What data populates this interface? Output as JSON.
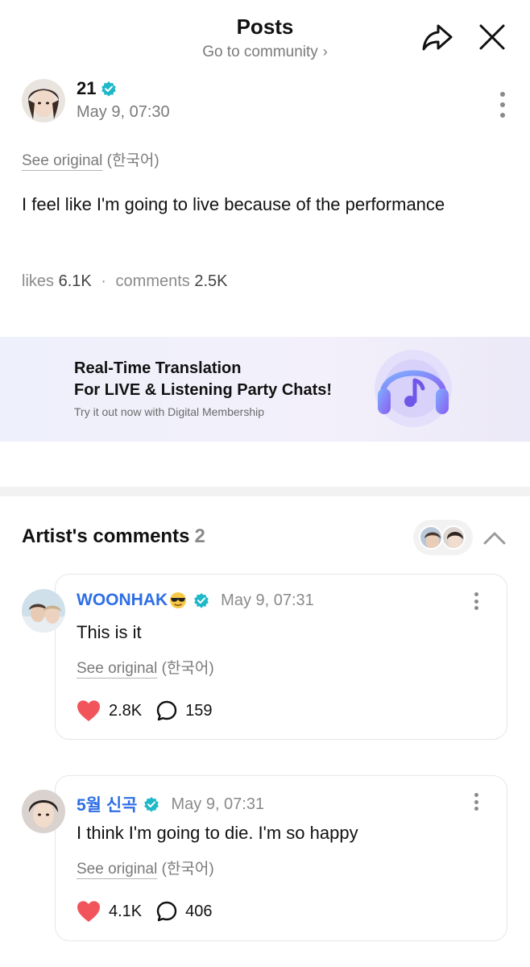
{
  "header": {
    "title": "Posts",
    "subtitle": "Go to community",
    "subtitle_chevron": "›"
  },
  "post": {
    "author": "21",
    "time": "May 9, 07:30",
    "see_original": "See original",
    "original_lang": "(한국어)",
    "body": "I feel like I'm going to live because of the performance",
    "likes_label": "likes",
    "likes_value": "6.1K",
    "separator": "·",
    "comments_label": "comments",
    "comments_value": "2.5K"
  },
  "banner": {
    "line1": "Real-Time Translation",
    "line2": "For LIVE & Listening Party Chats!",
    "line3": "Try it out now with Digital Membership"
  },
  "artist_comments": {
    "title": "Artist's comments",
    "count": "2",
    "items": [
      {
        "name": "WOONHAK",
        "time": "May 9, 07:31",
        "text": "This is it",
        "see_original": "See original",
        "original_lang": "(한국어)",
        "likes": "2.8K",
        "replies": "159"
      },
      {
        "name": "5월 신곡",
        "time": "May 9, 07:31",
        "text": "I think I'm going to die. I'm so happy",
        "see_original": "See original",
        "original_lang": "(한국어)",
        "likes": "4.1K",
        "replies": "406"
      }
    ]
  },
  "colors": {
    "accent_blue": "#2e6ee6",
    "verified_teal": "#1fb8c9",
    "heart_red": "#f2545b",
    "banner_icon_purple": "#8a6cf0"
  },
  "icons": [
    "share-icon",
    "close-icon",
    "verified-icon",
    "more-vertical-icon",
    "headphones-music-icon",
    "chevron-up-icon",
    "heart-icon",
    "comment-bubble-icon",
    "sunglasses-emoji-icon"
  ]
}
